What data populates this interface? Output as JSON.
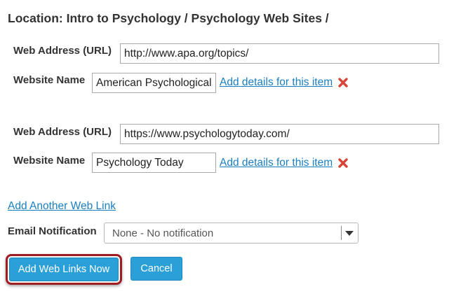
{
  "location": {
    "text": "Location: Intro to Psychology / Psychology Web Sites /"
  },
  "links": [
    {
      "url_label": "Web Address (URL)",
      "url_value": "http://www.apa.org/topics/",
      "name_label": "Website Name",
      "name_value": "American Psychological",
      "details_link": "Add details for this item",
      "remove_icon": "red-x-icon"
    },
    {
      "url_label": "Web Address (URL)",
      "url_value": "https://www.psychologytoday.com/",
      "name_label": "Website Name",
      "name_value": "Psychology Today",
      "details_link": "Add details for this item",
      "remove_icon": "red-x-icon"
    }
  ],
  "add_another": "Add Another Web Link",
  "notification": {
    "label": "Email Notification",
    "selected": "None - No notification"
  },
  "buttons": {
    "submit": "Add Web Links Now",
    "cancel": "Cancel"
  },
  "colors": {
    "link": "#1a7fc1",
    "button": "#2a9fd8",
    "remove": "#d9443a",
    "highlight": "#9e1d22"
  }
}
